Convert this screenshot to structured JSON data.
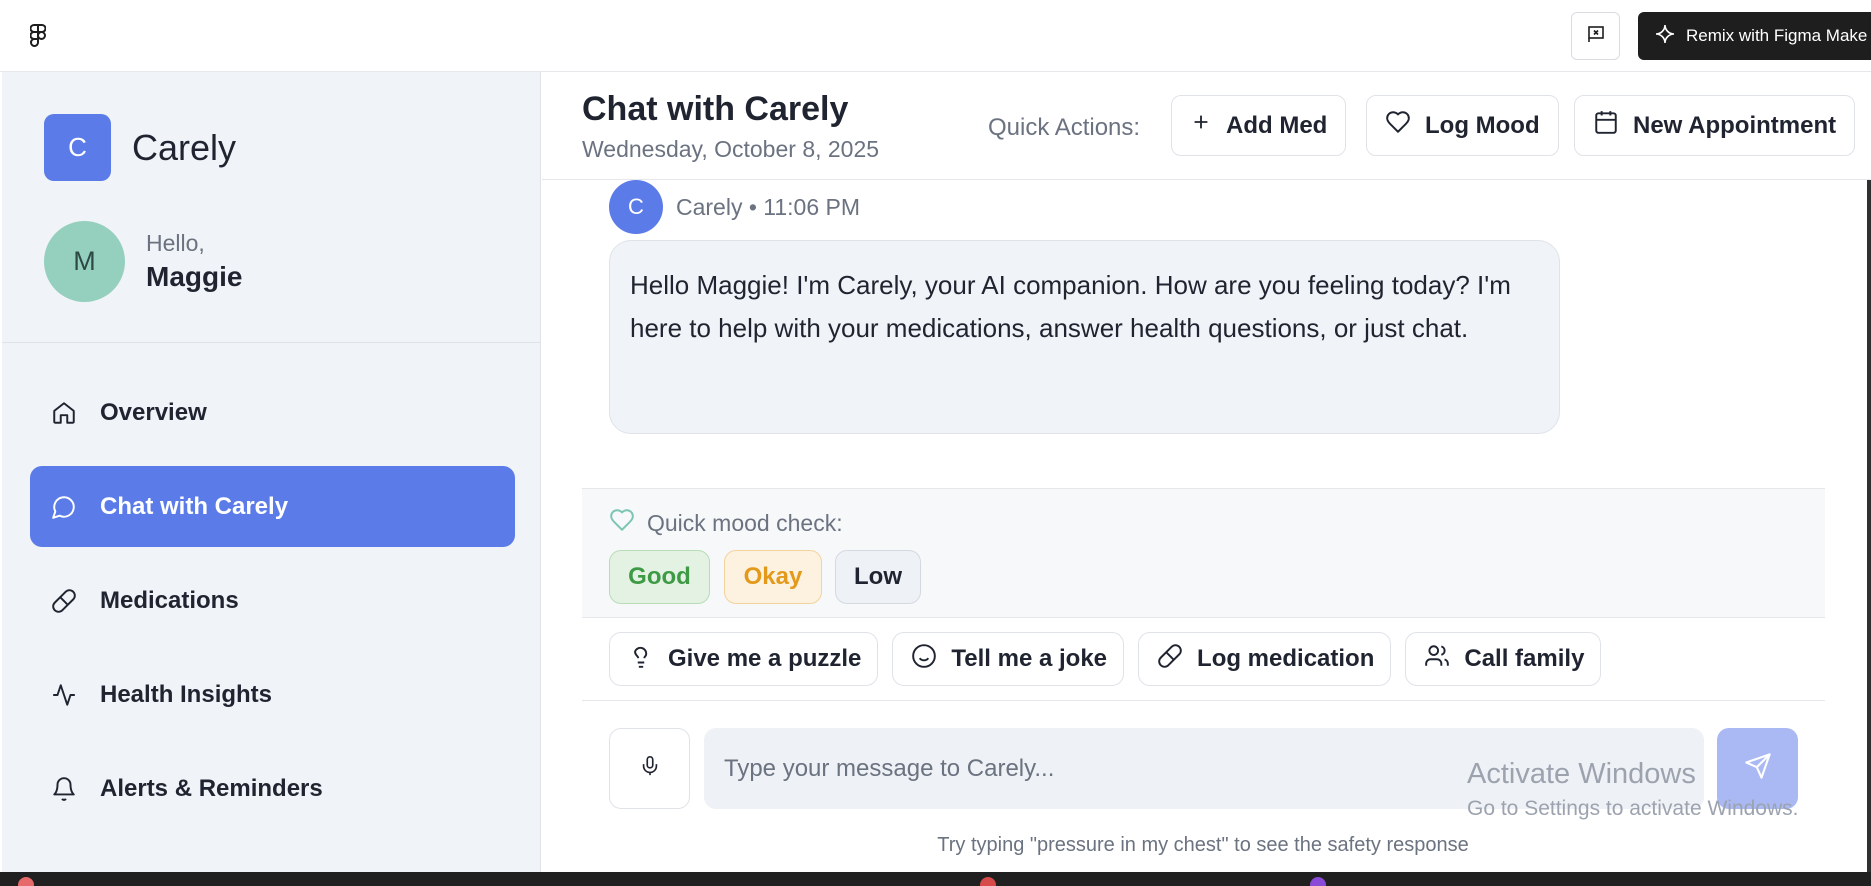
{
  "topbar": {
    "remix_label": "Remix with Figma Make",
    "icons": {
      "logo": "figma-logo-icon",
      "report": "report-flag-icon",
      "remix": "figma-make-icon"
    }
  },
  "sidebar": {
    "brand_letter": "C",
    "brand_name": "Carely",
    "avatar_letter": "M",
    "greeting": "Hello,",
    "user_name": "Maggie",
    "items": [
      {
        "label": "Overview",
        "icon": "home-icon",
        "active": false
      },
      {
        "label": "Chat with Carely",
        "icon": "chat-icon",
        "active": true
      },
      {
        "label": "Medications",
        "icon": "pill-icon",
        "active": false
      },
      {
        "label": "Health Insights",
        "icon": "activity-icon",
        "active": false
      },
      {
        "label": "Alerts & Reminders",
        "icon": "bell-icon",
        "active": false
      }
    ]
  },
  "header": {
    "title": "Chat with Carely",
    "date": "Wednesday, October 8, 2025",
    "quick_actions_label": "Quick Actions:",
    "actions": [
      {
        "label": "Add Med",
        "icon": "plus-icon"
      },
      {
        "label": "Log Mood",
        "icon": "heart-icon"
      },
      {
        "label": "New Appointment",
        "icon": "calendar-icon"
      }
    ]
  },
  "chat": {
    "message": {
      "avatar_letter": "C",
      "meta": "Carely • 11:06 PM",
      "text": "Hello Maggie! I'm Carely, your AI companion. How are you feeling today? I'm here to help with your medications, answer health questions, or just chat."
    },
    "mood": {
      "label": "Quick mood check:",
      "options": [
        "Good",
        "Okay",
        "Low"
      ]
    },
    "suggestions": [
      {
        "label": "Give me a puzzle",
        "icon": "lightbulb-icon"
      },
      {
        "label": "Tell me a joke",
        "icon": "smile-icon"
      },
      {
        "label": "Log medication",
        "icon": "pill-icon"
      },
      {
        "label": "Call family",
        "icon": "users-icon"
      }
    ],
    "input_placeholder": "Type your message to Carely...",
    "hint": "Try typing \"pressure in my chest\" to see the safety response"
  },
  "watermark": {
    "line1": "Activate Windows",
    "line2": "Go to Settings to activate Windows."
  },
  "colors": {
    "accent": "#5b7be9",
    "sidebar_bg": "#f0f3f7",
    "good": "#3f9a45",
    "okay": "#e39a1b",
    "mood_heart": "#7cc5b3"
  }
}
